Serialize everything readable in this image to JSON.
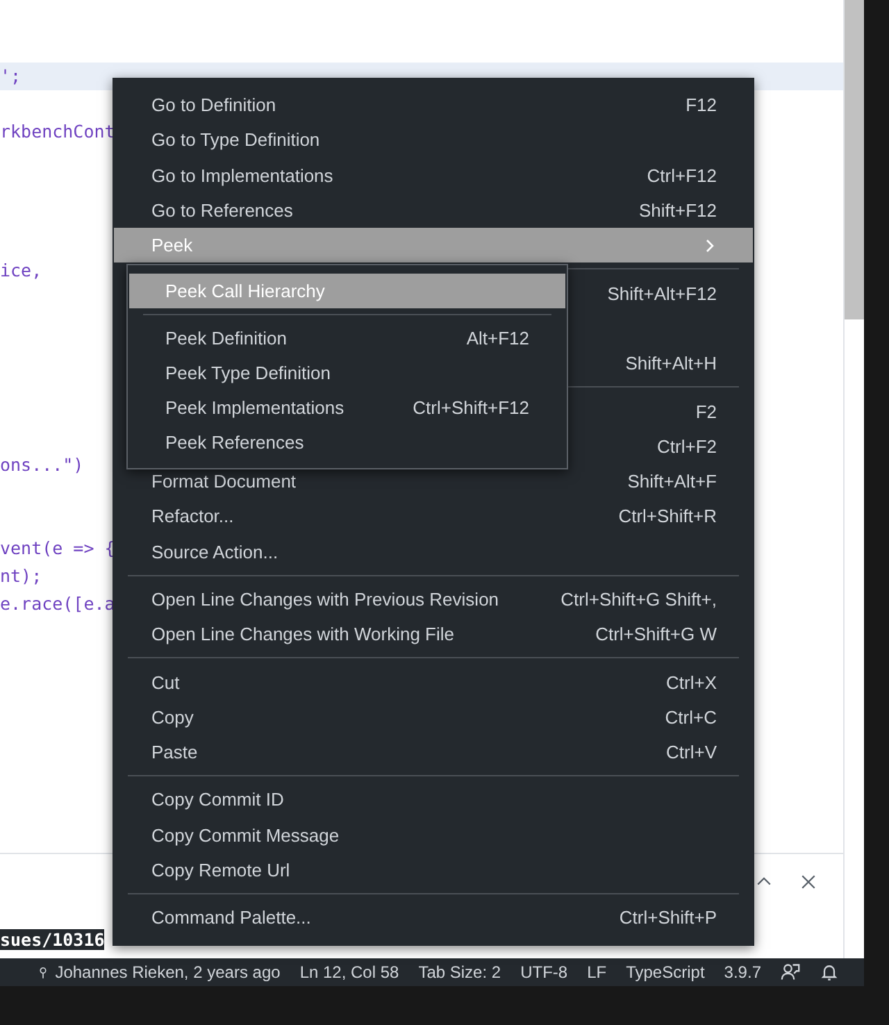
{
  "editor": {
    "code_lines": [
      {
        "text": "';",
        "current": true
      },
      {
        "text": "rkbenchCont",
        "current": false
      },
      {
        "text": "ice,",
        "current": false
      },
      {
        "text": "ons...\")",
        "current": false
      },
      {
        "text": "vent(e => {",
        "current": false
      },
      {
        "text": "nt);",
        "current": false
      },
      {
        "text": "e.race([e.a",
        "current": false
      }
    ]
  },
  "panel": {
    "text": "sues/10316"
  },
  "context_menu": {
    "groups": [
      [
        {
          "label": "Go to Definition",
          "shortcut": "F12",
          "selected": false
        },
        {
          "label": "Go to Type Definition",
          "selected": false
        },
        {
          "label": "Go to Implementations",
          "shortcut": "Ctrl+F12",
          "selected": false
        },
        {
          "label": "Go to References",
          "shortcut": "Shift+F12",
          "selected": false
        },
        {
          "label": "Peek",
          "submenu": true,
          "selected": true
        }
      ],
      [
        {
          "shortcut": "Shift+Alt+F12",
          "selected": false
        },
        {
          "selected": false
        },
        {
          "shortcut": "Shift+Alt+H",
          "selected": false
        }
      ],
      [
        {
          "shortcut": "F2",
          "selected": false
        },
        {
          "shortcut": "Ctrl+F2",
          "selected": false
        },
        {
          "label": "Format Document",
          "shortcut": "Shift+Alt+F",
          "selected": false
        },
        {
          "label": "Refactor...",
          "shortcut": "Ctrl+Shift+R",
          "selected": false
        },
        {
          "label": "Source Action...",
          "selected": false
        }
      ],
      [
        {
          "label": "Open Line Changes with Previous Revision",
          "shortcut": "Ctrl+Shift+G Shift+,",
          "selected": false
        },
        {
          "label": "Open Line Changes with Working File",
          "shortcut": "Ctrl+Shift+G W",
          "selected": false
        }
      ],
      [
        {
          "label": "Cut",
          "shortcut": "Ctrl+X",
          "selected": false
        },
        {
          "label": "Copy",
          "shortcut": "Ctrl+C",
          "selected": false
        },
        {
          "label": "Paste",
          "shortcut": "Ctrl+V",
          "selected": false
        }
      ],
      [
        {
          "label": "Copy Commit ID",
          "selected": false
        },
        {
          "label": "Copy Commit Message",
          "selected": false
        },
        {
          "label": "Copy Remote Url",
          "selected": false
        }
      ],
      [
        {
          "label": "Command Palette...",
          "shortcut": "Ctrl+Shift+P",
          "selected": false
        }
      ]
    ]
  },
  "submenu": {
    "groups": [
      [
        {
          "label": "Peek Call Hierarchy",
          "selected": true
        }
      ],
      [
        {
          "label": "Peek Definition",
          "shortcut": "Alt+F12",
          "selected": false
        },
        {
          "label": "Peek Type Definition",
          "selected": false
        },
        {
          "label": "Peek Implementations",
          "shortcut": "Ctrl+Shift+F12",
          "selected": false
        },
        {
          "label": "Peek References",
          "selected": false
        }
      ]
    ]
  },
  "status_bar": {
    "items": [
      {
        "text": "Johannes Rieken, 2 years ago",
        "kind": "blame"
      },
      {
        "text": "Ln 12, Col 58",
        "kind": "text"
      },
      {
        "text": "Tab Size: 2",
        "kind": "text"
      },
      {
        "text": "UTF-8",
        "kind": "text"
      },
      {
        "text": "LF",
        "kind": "text"
      },
      {
        "text": "TypeScript",
        "kind": "text"
      },
      {
        "text": "3.9.7",
        "kind": "text"
      },
      {
        "kind": "feedback"
      },
      {
        "kind": "bell"
      }
    ]
  }
}
